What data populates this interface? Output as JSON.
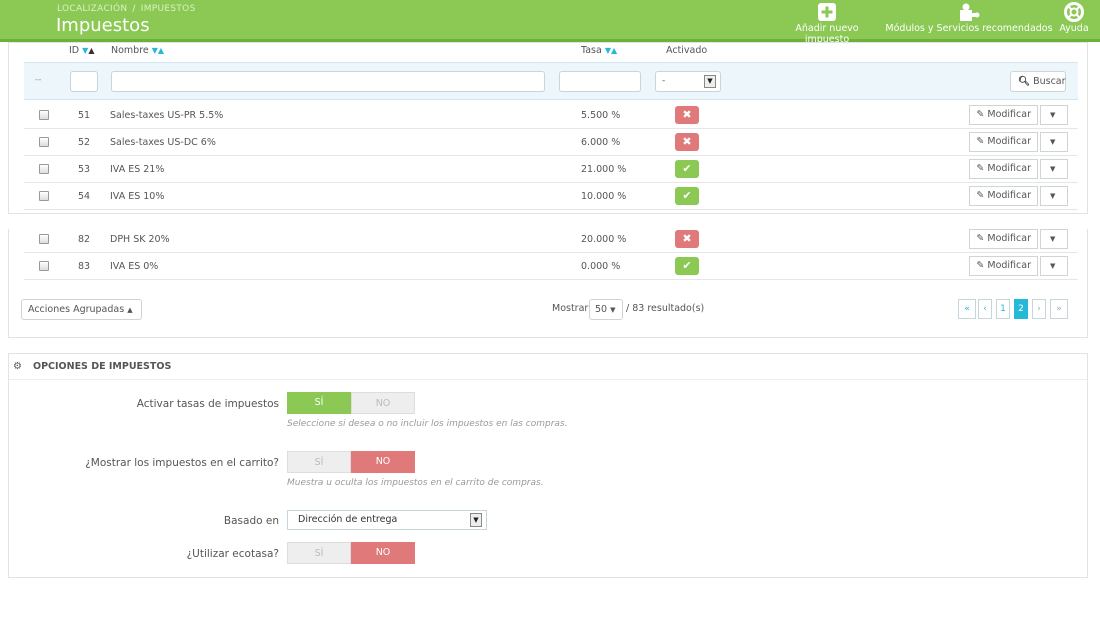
{
  "header": {
    "breadcrumb": [
      "LOCALIZACIÓN",
      "IMPUESTOS"
    ],
    "breadcrumb_sep": "/",
    "title": "Impuestos",
    "toolbar": [
      {
        "label": "Añadir nuevo impuesto",
        "icon": "plus-square-icon"
      },
      {
        "label": "Módulos y Servicios recomendados",
        "icon": "puzzle-icon"
      },
      {
        "label": "Ayuda",
        "icon": "lifebuoy-icon"
      }
    ],
    "colors": {
      "brand": "#8bc954",
      "accent": "#25b9d7",
      "danger": "#e07a7a"
    }
  },
  "table": {
    "columns": {
      "id": "ID",
      "name": "Nombre",
      "rate": "Tasa",
      "active": "Activado"
    },
    "filter": {
      "id_placeholder": "",
      "name_placeholder": "",
      "rate_placeholder": "",
      "active_value": "-",
      "dash": "--",
      "search_label": "Buscar"
    },
    "rows": [
      {
        "id": "51",
        "name": "Sales-taxes US-PR 5.5%",
        "rate": "5.500 %",
        "active": false,
        "action": "Modificar"
      },
      {
        "id": "52",
        "name": "Sales-taxes US-DC 6%",
        "rate": "6.000 %",
        "active": false,
        "action": "Modificar"
      },
      {
        "id": "53",
        "name": "IVA ES 21%",
        "rate": "21.000 %",
        "active": true,
        "action": "Modificar"
      },
      {
        "id": "54",
        "name": "IVA ES 10%",
        "rate": "10.000 %",
        "active": true,
        "action": "Modificar"
      },
      {
        "id": "82",
        "name": "DPH SK 20%",
        "rate": "20.000 %",
        "active": false,
        "action": "Modificar"
      },
      {
        "id": "83",
        "name": "IVA ES 0%",
        "rate": "0.000 %",
        "active": true,
        "action": "Modificar"
      }
    ],
    "bulk_actions": "Acciones Agrupadas",
    "show_label": "Mostrar",
    "per_page": "50",
    "results": "/ 83 resultado(s)",
    "pagination": {
      "first": "«",
      "prev": "‹",
      "pages": [
        "1",
        "2"
      ],
      "current": "2",
      "next": "›",
      "last": "»"
    }
  },
  "options": {
    "heading": "OPCIONES DE IMPUESTOS",
    "fields": [
      {
        "label": "Activar tasas de impuestos",
        "yes": "SÍ",
        "no": "NO",
        "value": "yes",
        "help": "Seleccione si desea o no incluir los impuestos en las compras."
      },
      {
        "label": "¿Mostrar los impuestos en el carrito?",
        "yes": "SÍ",
        "no": "NO",
        "value": "no",
        "help": "Muestra u oculta los impuestos en el carrito de compras."
      },
      {
        "label": "Basado en",
        "select_value": "Dirección de entrega"
      },
      {
        "label": "¿Utilizar ecotasa?",
        "yes": "SÍ",
        "no": "NO",
        "value": "no"
      }
    ]
  }
}
